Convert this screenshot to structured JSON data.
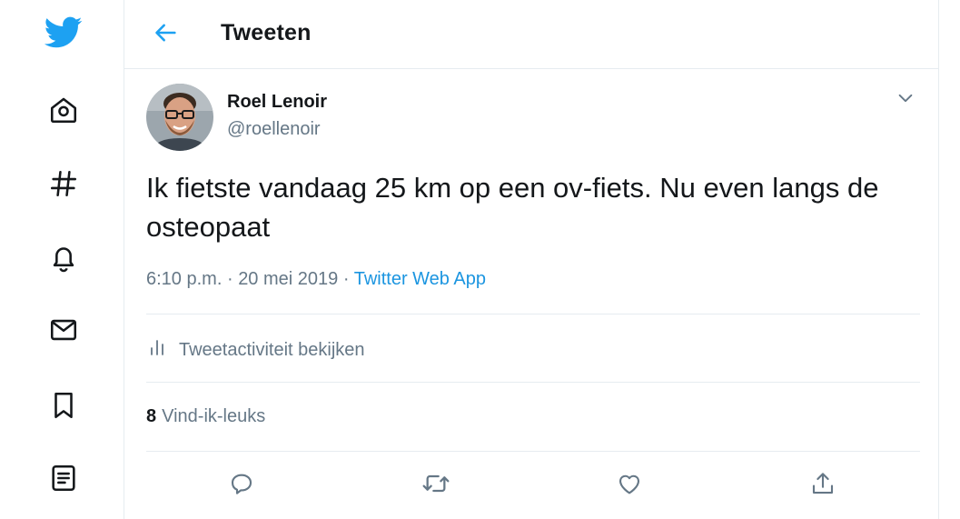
{
  "nav": {
    "items": [
      {
        "icon": "twitter-logo-icon"
      },
      {
        "icon": "home-icon"
      },
      {
        "icon": "hashtag-icon"
      },
      {
        "icon": "bell-icon"
      },
      {
        "icon": "mail-icon"
      },
      {
        "icon": "bookmark-icon"
      },
      {
        "icon": "list-icon"
      }
    ]
  },
  "header": {
    "title": "Tweeten"
  },
  "tweet": {
    "author_name": "Roel Lenoir",
    "author_handle": "@roellenoir",
    "text": "Ik fietste vandaag 25 km op een ov-fiets. Nu even langs de osteopaat",
    "time": "6:10 p.m.",
    "separator": "·",
    "date": "20 mei 2019",
    "source": "Twitter Web App",
    "activity_label": "Tweetactiviteit bekijken",
    "likes_count": "8",
    "likes_label": "Vind-ik-leuks"
  },
  "colors": {
    "accent": "#1da1f2",
    "link": "#1b95e0",
    "secondary_text": "#657786",
    "primary_text": "#14171a",
    "border": "#e6ecf0"
  }
}
